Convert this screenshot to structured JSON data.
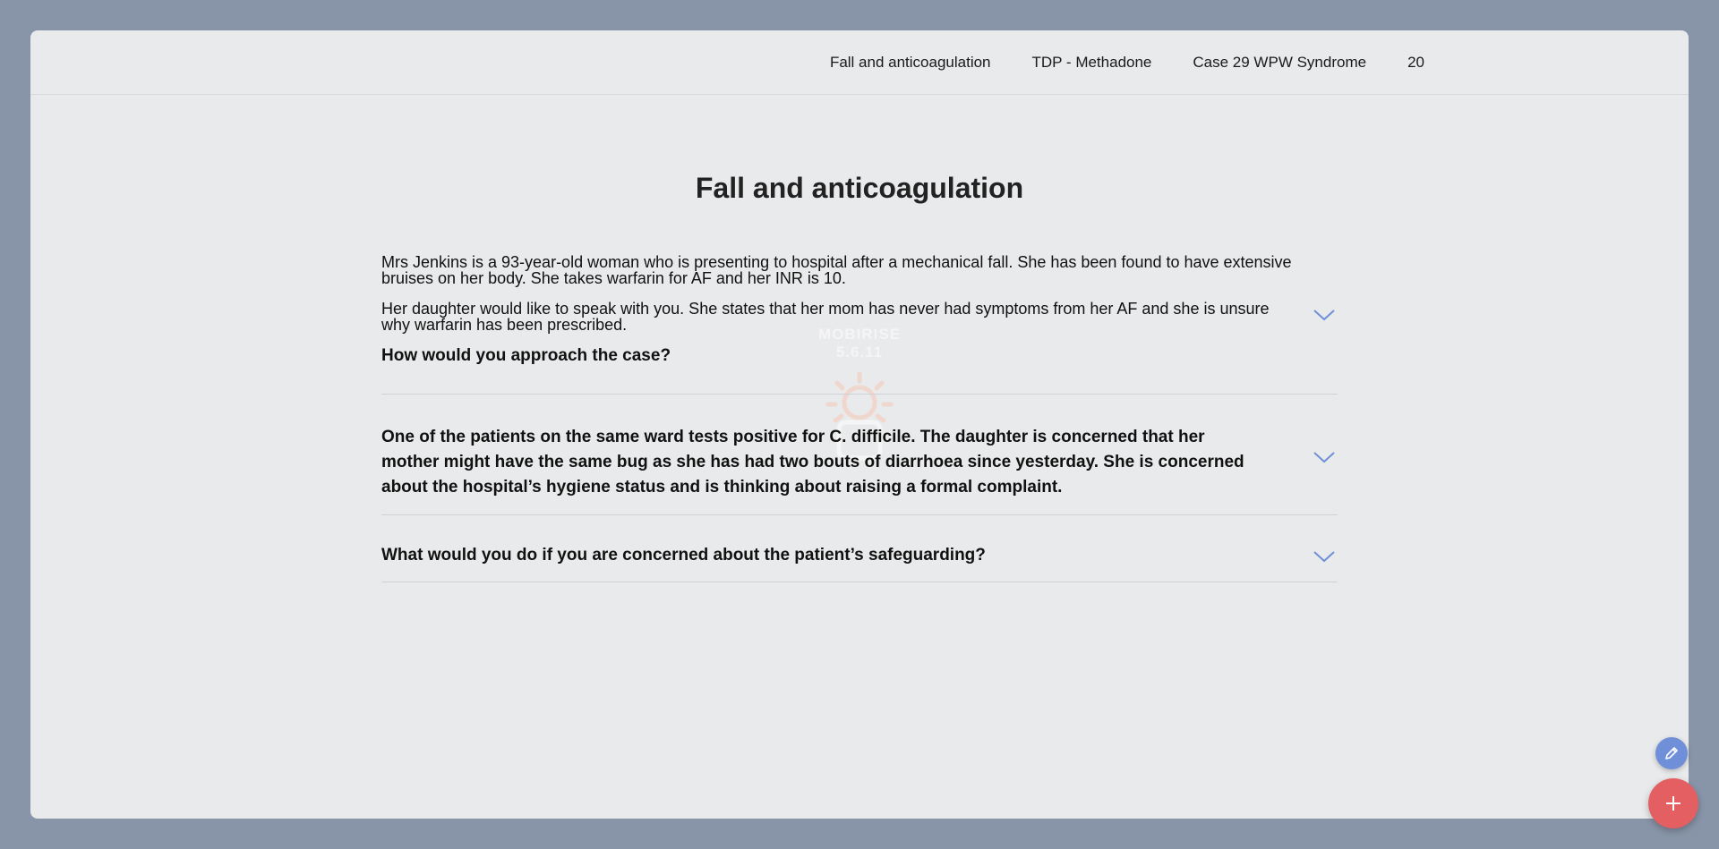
{
  "nav": {
    "items": [
      {
        "label": "Fall and anticoagulation"
      },
      {
        "label": "TDP - Methadone"
      },
      {
        "label": "Case 29 WPW Syndrome"
      },
      {
        "label": "20"
      }
    ]
  },
  "page": {
    "title": "Fall and anticoagulation"
  },
  "case": {
    "paragraphs": [
      "Mrs Jenkins is a 93-year-old woman who is presenting to hospital after a mechanical fall. She has been found to have extensive bruises on her body. She takes warfarin for AF and her INR is 10.",
      "Her daughter would like to speak with you. She states that her mom has never had symptoms from her AF and she is unsure why warfarin has been prescribed."
    ]
  },
  "accordion": {
    "items": [
      {
        "question": "How would you approach the case?",
        "icon": "chevron-down-icon"
      },
      {
        "question": "One of the patients on the same ward tests positive for C. difficile. The daughter is concerned that her mother might have the same bug as she has had two bouts of diarrhoea since yesterday. She is concerned about the hospital’s hygiene status and is thinking about raising a formal complaint.",
        "icon": "chevron-down-icon"
      },
      {
        "question": "What would you do if you are concerned about the patient’s safeguarding?",
        "icon": "chevron-down-icon"
      }
    ]
  },
  "watermark": {
    "text": "MOBIRISE 5.6.11"
  },
  "fabs": {
    "edit_icon": "pencil-icon",
    "add_icon": "plus-icon"
  },
  "colors": {
    "background": "#8894a8",
    "panel": "#e9eaeb",
    "accent_chevron": "#6f8fd8",
    "fab_edit": "#6f8fd8",
    "fab_add": "#e35f62"
  }
}
